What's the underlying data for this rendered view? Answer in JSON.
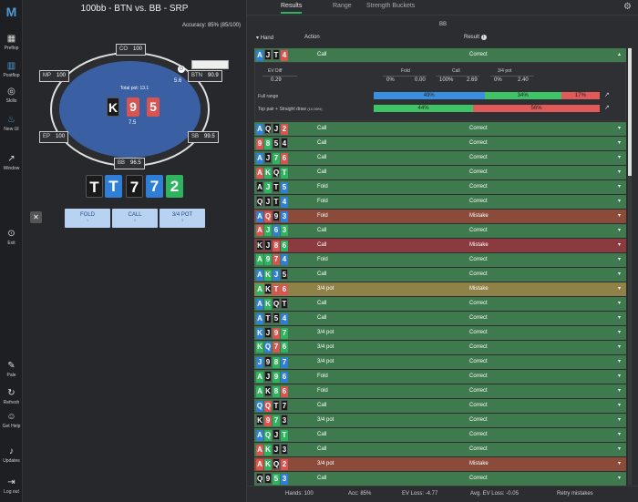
{
  "sidebar": {
    "items": [
      {
        "label": "Preflop",
        "icon": "grid-icon"
      },
      {
        "label": "Postflop",
        "icon": "chip-icon"
      },
      {
        "label": "Skills",
        "icon": "target-icon"
      },
      {
        "label": "New UI",
        "icon": "flame-icon"
      },
      {
        "label": "Window",
        "icon": "external-icon"
      },
      {
        "label": "Exit",
        "icon": "exit-icon"
      },
      {
        "label": "Pale",
        "icon": "brush-icon"
      },
      {
        "label": "Refresh",
        "icon": "refresh-icon"
      },
      {
        "label": "Get Help",
        "icon": "discord-icon"
      },
      {
        "label": "Updates",
        "icon": "bell-icon"
      },
      {
        "label": "Log out",
        "icon": "logout-icon"
      }
    ]
  },
  "left": {
    "title": "100bb - BTN vs. BB - SRP",
    "accuracy_label": "Accuracy:",
    "accuracy_value": "85% (85/100)",
    "seats": {
      "co": {
        "name": "CO",
        "stack": "100"
      },
      "mp": {
        "name": "MP",
        "stack": "100"
      },
      "btn": {
        "name": "BTN",
        "stack": "90.9"
      },
      "ep": {
        "name": "EP",
        "stack": "100"
      },
      "sb": {
        "name": "SB",
        "stack": "99.5"
      },
      "bb": {
        "name": "BB",
        "stack": "96.5"
      }
    },
    "btn_bet": "5.6",
    "bb_bet": "7.5",
    "total_pot": "Total pot: 13.1",
    "hero_cards": [
      {
        "rank": "K",
        "suit": "s"
      },
      {
        "rank": "9",
        "suit": "h"
      },
      {
        "rank": "5",
        "suit": "h"
      }
    ],
    "board": [
      {
        "rank": "T",
        "suit": "s"
      },
      {
        "rank": "T",
        "suit": "d"
      },
      {
        "rank": "7",
        "suit": "s"
      },
      {
        "rank": "7",
        "suit": "d"
      },
      {
        "rank": "2",
        "suit": "c"
      }
    ],
    "actions": [
      {
        "label": "FOLD",
        "key": "1"
      },
      {
        "label": "CALL",
        "key": "2"
      },
      {
        "label": "3/4 POT",
        "key": "3"
      }
    ]
  },
  "right": {
    "tabs": [
      "Results",
      "Range",
      "Strength Buckets"
    ],
    "player": "BB",
    "headers": {
      "hand": "Hand",
      "action": "Action",
      "result": "Result"
    },
    "expanded": {
      "cards": [
        {
          "r": "A",
          "s": "d"
        },
        {
          "r": "J",
          "s": "s"
        },
        {
          "r": "T",
          "s": "s"
        },
        {
          "r": "4",
          "s": "h"
        }
      ],
      "action": "Call",
      "result": "Correct",
      "ev_diff_label": "EV Diff",
      "ev_diff": "0.29",
      "fold_label": "Fold",
      "fold_pct": "0%",
      "fold_ev": "0.00",
      "call_label": "Call",
      "call_pct": "100%",
      "call_ev": "2.69",
      "pot_label": "3/4 pot",
      "pot_pct": "0%",
      "pot_ev": "2.40",
      "full_range_label": "Full range",
      "full_range": {
        "blue": "49%",
        "green": "34%",
        "red": "17%",
        "blue_frac": 0.49,
        "green_frac": 0.34,
        "red_frac": 0.17
      },
      "bucket_label": "Top pair + Straight draw",
      "bucket_extra": "(10.06%)",
      "bucket": {
        "green": "44%",
        "red": "56%",
        "green_frac": 0.44,
        "red_frac": 0.56
      }
    },
    "rows": [
      {
        "cards": [
          [
            "A",
            "d"
          ],
          [
            "Q",
            "s"
          ],
          [
            "J",
            "s"
          ],
          [
            "2",
            "h"
          ]
        ],
        "action": "Call",
        "result": "Correct",
        "c": "g"
      },
      {
        "cards": [
          [
            "9",
            "h"
          ],
          [
            "8",
            "c"
          ],
          [
            "5",
            "s"
          ],
          [
            "4",
            "s"
          ]
        ],
        "action": "Call",
        "result": "Correct",
        "c": "g"
      },
      {
        "cards": [
          [
            "A",
            "d"
          ],
          [
            "J",
            "s"
          ],
          [
            "7",
            "c"
          ],
          [
            "6",
            "h"
          ]
        ],
        "action": "Call",
        "result": "Correct",
        "c": "g"
      },
      {
        "cards": [
          [
            "A",
            "h"
          ],
          [
            "K",
            "c"
          ],
          [
            "Q",
            "s"
          ],
          [
            "T",
            "c"
          ]
        ],
        "action": "Call",
        "result": "Correct",
        "c": "g"
      },
      {
        "cards": [
          [
            "A",
            "s"
          ],
          [
            "J",
            "c"
          ],
          [
            "T",
            "s"
          ],
          [
            "5",
            "d"
          ]
        ],
        "action": "Fold",
        "result": "Correct",
        "c": "g"
      },
      {
        "cards": [
          [
            "Q",
            "s"
          ],
          [
            "J",
            "s"
          ],
          [
            "T",
            "s"
          ],
          [
            "4",
            "d"
          ]
        ],
        "action": "Fold",
        "result": "Correct",
        "c": "g"
      },
      {
        "cards": [
          [
            "A",
            "d"
          ],
          [
            "Q",
            "h"
          ],
          [
            "9",
            "s"
          ],
          [
            "3",
            "d"
          ]
        ],
        "action": "Fold",
        "result": "Mistake",
        "c": "r"
      },
      {
        "cards": [
          [
            "A",
            "h"
          ],
          [
            "J",
            "c"
          ],
          [
            "6",
            "d"
          ],
          [
            "3",
            "c"
          ]
        ],
        "action": "Call",
        "result": "Correct",
        "c": "g"
      },
      {
        "cards": [
          [
            "K",
            "s"
          ],
          [
            "J",
            "s"
          ],
          [
            "8",
            "h"
          ],
          [
            "6",
            "c"
          ]
        ],
        "action": "Call",
        "result": "Mistake",
        "c": "rr"
      },
      {
        "cards": [
          [
            "A",
            "c"
          ],
          [
            "9",
            "c"
          ],
          [
            "7",
            "h"
          ],
          [
            "4",
            "d"
          ]
        ],
        "action": "Fold",
        "result": "Correct",
        "c": "g"
      },
      {
        "cards": [
          [
            "A",
            "d"
          ],
          [
            "K",
            "c"
          ],
          [
            "J",
            "d"
          ],
          [
            "5",
            "s"
          ]
        ],
        "action": "Call",
        "result": "Correct",
        "c": "g"
      },
      {
        "cards": [
          [
            "A",
            "c"
          ],
          [
            "K",
            "s"
          ],
          [
            "T",
            "h"
          ],
          [
            "6",
            "h"
          ]
        ],
        "action": "3/4 pot",
        "result": "Mistake",
        "c": "y"
      },
      {
        "cards": [
          [
            "A",
            "d"
          ],
          [
            "K",
            "c"
          ],
          [
            "Q",
            "s"
          ],
          [
            "T",
            "s"
          ]
        ],
        "action": "Call",
        "result": "Correct",
        "c": "g"
      },
      {
        "cards": [
          [
            "A",
            "d"
          ],
          [
            "T",
            "s"
          ],
          [
            "5",
            "s"
          ],
          [
            "4",
            "d"
          ]
        ],
        "action": "Call",
        "result": "Correct",
        "c": "g"
      },
      {
        "cards": [
          [
            "K",
            "d"
          ],
          [
            "J",
            "s"
          ],
          [
            "9",
            "h"
          ],
          [
            "7",
            "c"
          ]
        ],
        "action": "3/4 pot",
        "result": "Correct",
        "c": "g"
      },
      {
        "cards": [
          [
            "K",
            "c"
          ],
          [
            "Q",
            "d"
          ],
          [
            "7",
            "h"
          ],
          [
            "6",
            "c"
          ]
        ],
        "action": "3/4 pot",
        "result": "Correct",
        "c": "g"
      },
      {
        "cards": [
          [
            "J",
            "d"
          ],
          [
            "9",
            "s"
          ],
          [
            "8",
            "c"
          ],
          [
            "7",
            "d"
          ]
        ],
        "action": "3/4 pot",
        "result": "Correct",
        "c": "g"
      },
      {
        "cards": [
          [
            "A",
            "c"
          ],
          [
            "J",
            "s"
          ],
          [
            "9",
            "c"
          ],
          [
            "6",
            "d"
          ]
        ],
        "action": "Fold",
        "result": "Correct",
        "c": "g"
      },
      {
        "cards": [
          [
            "A",
            "c"
          ],
          [
            "K",
            "s"
          ],
          [
            "8",
            "c"
          ],
          [
            "6",
            "h"
          ]
        ],
        "action": "Fold",
        "result": "Correct",
        "c": "g"
      },
      {
        "cards": [
          [
            "Q",
            "d"
          ],
          [
            "Q",
            "h"
          ],
          [
            "T",
            "s"
          ],
          [
            "7",
            "s"
          ]
        ],
        "action": "Call",
        "result": "Correct",
        "c": "g"
      },
      {
        "cards": [
          [
            "K",
            "s"
          ],
          [
            "9",
            "h"
          ],
          [
            "7",
            "c"
          ],
          [
            "3",
            "s"
          ]
        ],
        "action": "3/4 pot",
        "result": "Correct",
        "c": "g"
      },
      {
        "cards": [
          [
            "A",
            "d"
          ],
          [
            "Q",
            "c"
          ],
          [
            "J",
            "s"
          ],
          [
            "T",
            "c"
          ]
        ],
        "action": "Call",
        "result": "Correct",
        "c": "g"
      },
      {
        "cards": [
          [
            "A",
            "h"
          ],
          [
            "K",
            "c"
          ],
          [
            "J",
            "s"
          ],
          [
            "3",
            "s"
          ]
        ],
        "action": "Call",
        "result": "Correct",
        "c": "g"
      },
      {
        "cards": [
          [
            "A",
            "h"
          ],
          [
            "K",
            "c"
          ],
          [
            "Q",
            "s"
          ],
          [
            "2",
            "h"
          ]
        ],
        "action": "3/4 pot",
        "result": "Mistake",
        "c": "r"
      },
      {
        "cards": [
          [
            "Q",
            "s"
          ],
          [
            "9",
            "s"
          ],
          [
            "5",
            "c"
          ],
          [
            "3",
            "d"
          ]
        ],
        "action": "Call",
        "result": "Correct",
        "c": "g"
      }
    ],
    "footer": {
      "hands": "Hands: 100",
      "acc": "Acc: 85%",
      "ev_loss": "EV Loss: -4.77",
      "avg_ev_loss": "Avg. EV Loss: -0.05",
      "retry": "Retry mistakes"
    }
  }
}
